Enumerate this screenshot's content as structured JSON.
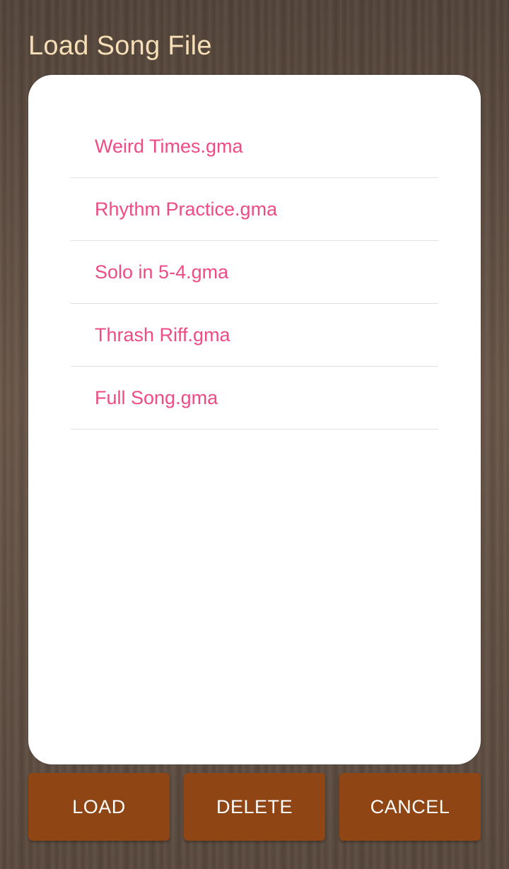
{
  "dialog": {
    "title": "Load Song File"
  },
  "files": [
    {
      "label": "Weird Times.gma"
    },
    {
      "label": "Rhythm Practice.gma"
    },
    {
      "label": "Solo in 5-4.gma"
    },
    {
      "label": "Thrash Riff.gma"
    },
    {
      "label": "Full Song.gma"
    }
  ],
  "buttons": {
    "load": "LOAD",
    "delete": "DELETE",
    "cancel": "CANCEL"
  },
  "colors": {
    "title_text": "#f6dfb7",
    "file_text": "#ee4b85",
    "button_bg": "#8f4514",
    "button_text": "#ffffff",
    "dialog_bg": "#ffffff"
  }
}
